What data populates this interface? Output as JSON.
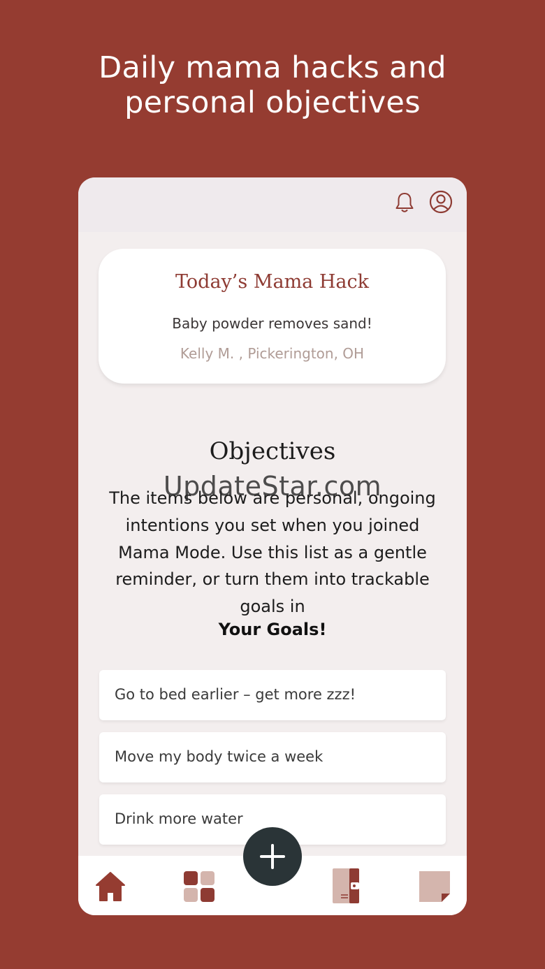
{
  "headline": {
    "line1": "Daily mama hacks and",
    "line2": "personal objectives"
  },
  "header": {
    "icons": [
      "bell-icon",
      "profile-icon"
    ]
  },
  "hack_card": {
    "title": "Today’s Mama Hack",
    "text": "Baby powder removes sand!",
    "author": "Kelly M. , Pickerington, OH"
  },
  "objectives": {
    "title": "Objectives",
    "description_lines": [
      "The items below are personal, ongoing",
      "intentions you set when you joined",
      "Mama Mode. Use this list as a gentle",
      "reminder, or turn them into trackable",
      "goals in"
    ],
    "link_text": "Your Goals!",
    "items": [
      "Go to bed earlier – get more zzz!",
      "Move my body twice a week",
      "Drink more water"
    ]
  },
  "watermark": "UpdateStar.com",
  "bottom_nav": {
    "icons": [
      "home-icon",
      "grid-icon",
      "add-icon",
      "journal-icon",
      "note-icon"
    ]
  },
  "colors": {
    "background": "#953c31",
    "accent": "#8e3b33",
    "muted_accent": "#d4b5ad",
    "fab": "#2a3437"
  }
}
